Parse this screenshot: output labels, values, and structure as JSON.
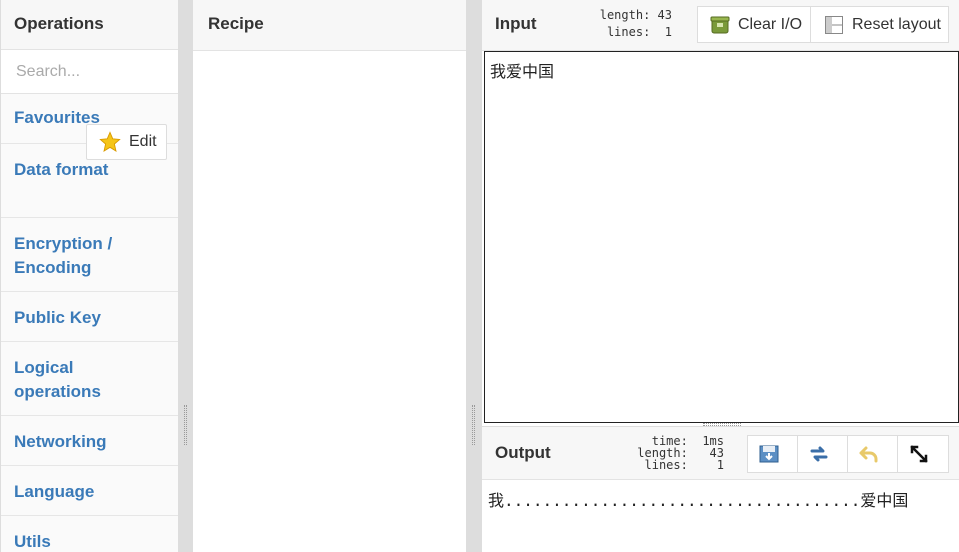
{
  "operations": {
    "title": "Operations",
    "search_placeholder": "Search...",
    "categories": [
      "Favourites",
      "Data format",
      "Encryption / Encoding",
      "Public Key",
      "Logical operations",
      "Networking",
      "Language",
      "Utils"
    ],
    "edit_label": "Edit"
  },
  "recipe": {
    "title": "Recipe"
  },
  "input": {
    "title": "Input",
    "length_label": "length:",
    "length_value": "43",
    "lines_label": "lines:",
    "lines_value": "1",
    "clear_label": "Clear I/O",
    "reset_label": "Reset layout",
    "text": "我爱中国"
  },
  "output": {
    "title": "Output",
    "time_label": "time:",
    "time_value": "1ms",
    "length_label": "length:",
    "length_value": "43",
    "lines_label": "lines:",
    "lines_value": "1",
    "text": "我.....................................爱中国"
  },
  "icons": [
    "star-icon",
    "clear-io-icon",
    "reset-layout-icon",
    "save-output-icon",
    "switch-io-icon",
    "undo-icon",
    "maximize-icon"
  ],
  "colors": {
    "category": "#3a7ab8",
    "star": "#f5c518"
  }
}
